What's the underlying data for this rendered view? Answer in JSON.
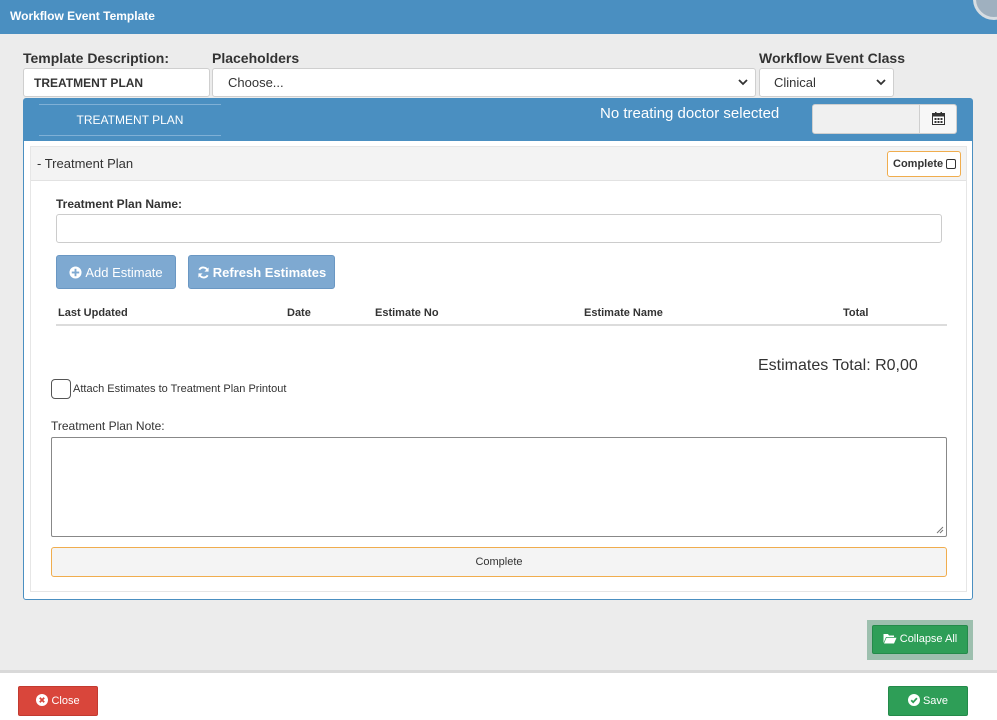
{
  "window": {
    "title": "Workflow Event Template"
  },
  "form": {
    "template_description_label": "Template Description:",
    "template_description_value": "TREATMENT PLAN",
    "placeholders_label": "Placeholders",
    "placeholders_value": "Choose...",
    "event_class_label": "Workflow Event Class",
    "event_class_value": "Clinical"
  },
  "panel": {
    "tab_label": "TREATMENT PLAN",
    "doctor_status": "No treating doctor selected",
    "date_value": ""
  },
  "section": {
    "title": "- Treatment Plan",
    "complete_label": "Complete",
    "plan_name_label": "Treatment Plan Name:",
    "plan_name_value": "",
    "add_estimate_label": "Add Estimate",
    "refresh_estimates_label": "Refresh Estimates",
    "table_headers": [
      "Last Updated",
      "Date",
      "Estimate No",
      "Estimate Name",
      "Total"
    ],
    "estimates_total": "Estimates Total: R0,00",
    "attach_label": "Attach Estimates to Treatment Plan Printout",
    "note_label": "Treatment Plan Note:",
    "note_value": "",
    "complete_button_label": "Complete"
  },
  "actions": {
    "collapse_all_label": "Collapse All",
    "close_label": "Close",
    "save_label": "Save"
  },
  "colors": {
    "header_blue": "#4a8fc1",
    "success_green": "#2e9e57",
    "danger_red": "#d9463b",
    "warning_orange": "#f0ad4e"
  }
}
